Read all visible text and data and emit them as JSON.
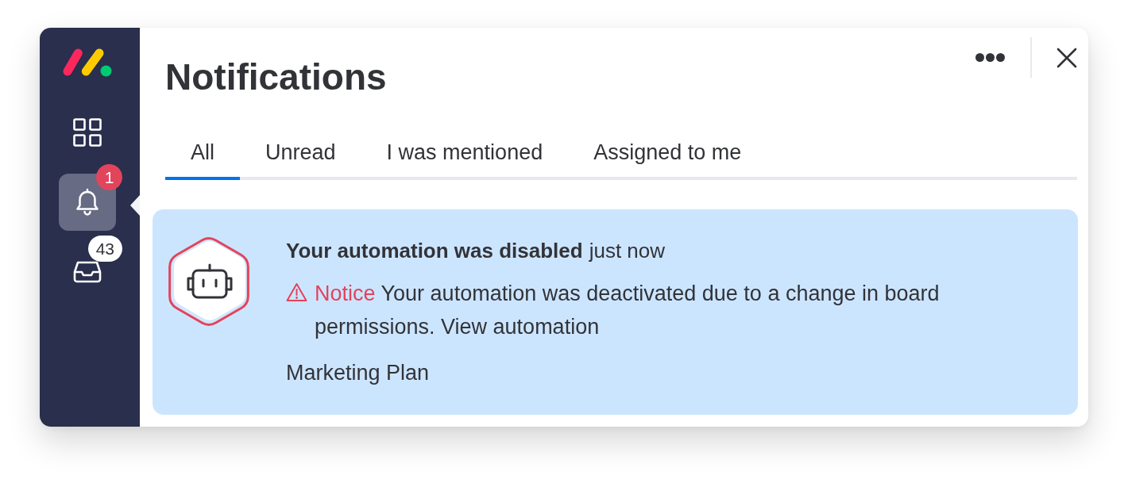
{
  "sidebar": {
    "items": [
      {
        "kind": "apps",
        "selected": false
      },
      {
        "kind": "notifications",
        "selected": true,
        "badge": {
          "text": "1",
          "color": "#e2445c"
        }
      },
      {
        "kind": "inbox",
        "selected": false,
        "badge": {
          "text": "43",
          "color": "#ffffff"
        }
      }
    ]
  },
  "panel": {
    "title": "Notifications"
  },
  "tabs": [
    {
      "label": "All",
      "selected": true
    },
    {
      "label": "Unread",
      "selected": false
    },
    {
      "label": "I was mentioned",
      "selected": false
    },
    {
      "label": "Assigned to me",
      "selected": false
    }
  ],
  "notifications": [
    {
      "kind": "automation",
      "unread": true,
      "title": "Your automation was disabled",
      "time": "just now",
      "notice": {
        "label": "Notice",
        "text": "Your automation was deactivated due to a change in board permissions. View automation"
      },
      "board": "Marketing Plan"
    }
  ]
}
